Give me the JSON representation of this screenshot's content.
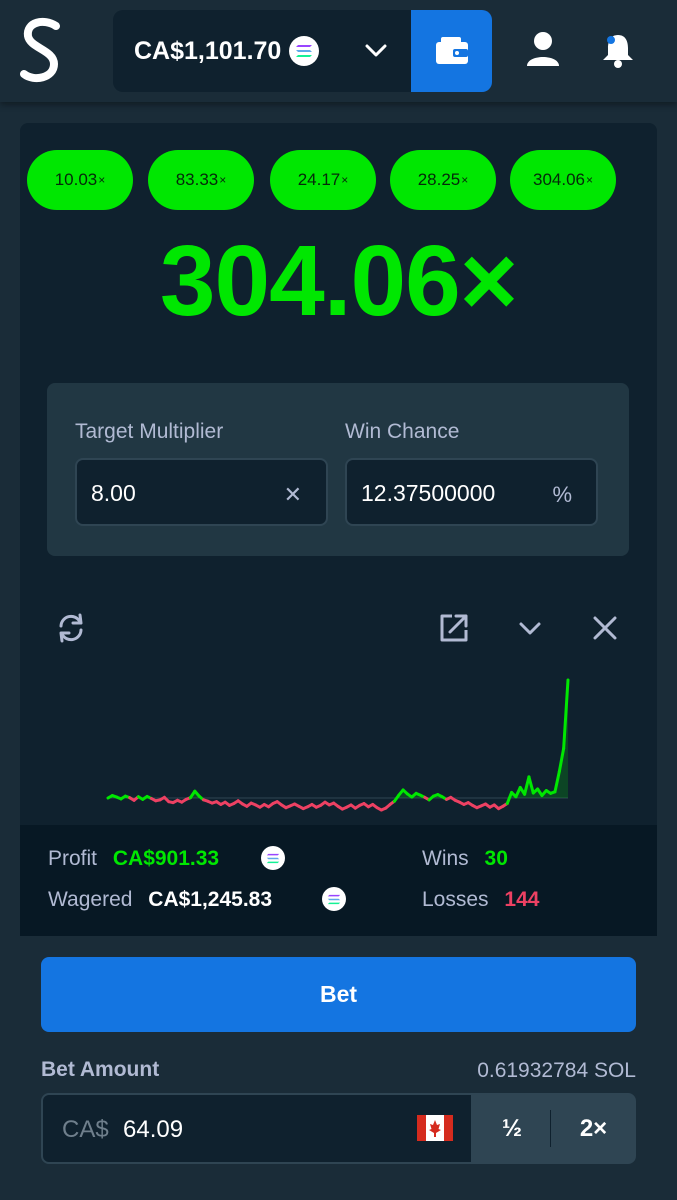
{
  "header": {
    "balance": "CA$1,101.70",
    "balance_currency_icon": "solana-icon",
    "dropdown_icon": "chevron-down-icon",
    "wallet_icon": "wallet-icon",
    "user_icon": "user-icon",
    "notifications_icon": "bell-icon",
    "colors": {
      "bar": "#1a2c38",
      "balance_bg": "#0f212e",
      "wallet_bg": "#1475e1"
    }
  },
  "history": {
    "multipliers": [
      "10.03",
      "83.33",
      "24.17",
      "28.25",
      "304.06"
    ],
    "suffix": "×",
    "pill_color": "#00e701"
  },
  "result": {
    "value": "304.06×",
    "color": "#00e701"
  },
  "settings": {
    "target_label": "Target Multiplier",
    "target_value": "8.00",
    "target_suffix": "✕",
    "chance_label": "Win Chance",
    "chance_value": "12.37500000",
    "chance_suffix": "%"
  },
  "chart_toolbar": {
    "refresh_icon": "refresh-icon",
    "popout_icon": "external-link-icon",
    "collapse_icon": "chevron-down-icon",
    "close_icon": "close-icon"
  },
  "chart_data": {
    "type": "line",
    "y": [
      0,
      0.8,
      0.3,
      -0.2,
      0.6,
      0.1,
      -0.5,
      0.4,
      -0.3,
      0.5,
      -0.1,
      -0.6,
      -0.4,
      0.2,
      -0.8,
      -1.0,
      -0.5,
      -0.9,
      -0.3,
      0.1,
      2.2,
      0.6,
      -0.4,
      -0.7,
      -1.1,
      -0.8,
      -1.4,
      -0.9,
      -1.6,
      -1.2,
      -0.6,
      -1.3,
      -1.8,
      -1.1,
      -1.5,
      -2.0,
      -1.4,
      -1.9,
      -1.2,
      -0.8,
      -1.5,
      -2.1,
      -1.7,
      -1.3,
      -1.8,
      -2.3,
      -1.9,
      -1.4,
      -2.0,
      -1.6,
      -0.9,
      -1.5,
      -1.1,
      -1.8,
      -2.4,
      -2.0,
      -1.5,
      -2.2,
      -1.6,
      -1.2,
      -1.9,
      -1.4,
      -2.1,
      -2.6,
      -2.2,
      -1.4,
      -0.7,
      0.9,
      2.6,
      1.3,
      0.3,
      1.5,
      0.9,
      0.2,
      -0.4,
      0.6,
      1.1,
      0.4,
      -0.3,
      0.2,
      -0.5,
      -0.9,
      -1.4,
      -1.0,
      -1.6,
      -2.1,
      -1.7,
      -1.3,
      -2.0,
      -1.5,
      -2.3,
      -1.8,
      -1.2,
      1.8,
      0.4,
      3.4,
      1.2,
      6.8,
      1.6,
      2.9,
      0.8,
      2.4,
      1.5,
      2.0,
      8.5,
      16.0,
      38.0
    ],
    "colors": {
      "profit": "#00e701",
      "loss": "#ed4163"
    },
    "grid": false,
    "legend": "none"
  },
  "stats": {
    "profit_label": "Profit",
    "profit_value": "CA$901.33",
    "wagered_label": "Wagered",
    "wagered_value": "CA$1,245.83",
    "wins_label": "Wins",
    "wins_value": "30",
    "losses_label": "Losses",
    "losses_value": "144"
  },
  "bet": {
    "button_label": "Bet",
    "amount_label": "Bet Amount",
    "amount_sol": "0.61932784 SOL",
    "currency_prefix": "CA$",
    "amount_value": "64.09",
    "flag_icon": "canada-flag-icon",
    "half_label": "½",
    "double_label": "2×"
  }
}
